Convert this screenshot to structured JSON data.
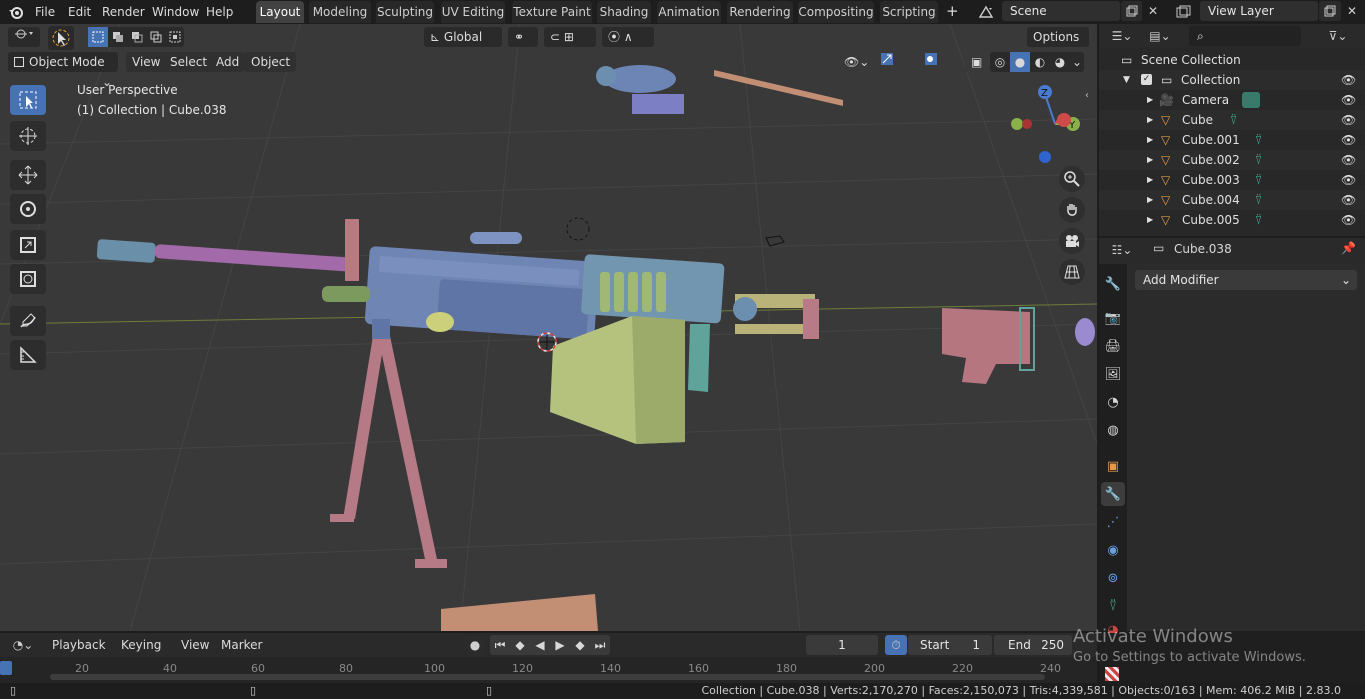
{
  "menu": {
    "items": [
      "File",
      "Edit",
      "Render",
      "Window",
      "Help"
    ]
  },
  "workspaces": {
    "tabs": [
      "Layout",
      "Modeling",
      "Sculpting",
      "UV Editing",
      "Texture Paint",
      "Shading",
      "Animation",
      "Rendering",
      "Compositing",
      "Scripting"
    ],
    "active": "Layout",
    "add_label": "+"
  },
  "scene": {
    "name": "Scene",
    "view_layer": "View Layer"
  },
  "viewport": {
    "mode_label": "Object Mode",
    "menus": [
      "View",
      "Select",
      "Add",
      "Object"
    ],
    "orientation": "Global",
    "options_label": "Options",
    "overlay_line1": "User Perspective",
    "overlay_line2": "(1) Collection | Cube.038",
    "gizmo_axes": {
      "z": "Z",
      "y": "Y"
    }
  },
  "outliner": {
    "search_placeholder": "",
    "root": "Scene Collection",
    "collection": "Collection",
    "items": [
      "Camera",
      "Cube",
      "Cube.001",
      "Cube.002",
      "Cube.003",
      "Cube.004",
      "Cube.005"
    ]
  },
  "properties": {
    "object_name": "Cube.038",
    "add_modifier_label": "Add Modifier"
  },
  "timeline": {
    "menus": [
      "Playback",
      "Keying",
      "View",
      "Marker"
    ],
    "current_frame": "1",
    "start_label": "Start",
    "start_value": "1",
    "end_label": "End",
    "end_value": "250",
    "ruler_ticks": [
      "20",
      "40",
      "60",
      "80",
      "100",
      "120",
      "140",
      "160",
      "180",
      "200",
      "220",
      "240"
    ]
  },
  "status": {
    "text": "Collection | Cube.038 | Verts:2,170,270 | Faces:2,150,073 | Tris:4,339,581 | Objects:0/163 | Mem: 406.2 MiB | 2.83.0"
  },
  "watermark": {
    "title": "Activate Windows",
    "subtitle": "Go to Settings to activate Windows."
  },
  "colors": {
    "accent": "#4772b3",
    "viewport_bg": "#393939",
    "panel_bg": "#2b2b2b",
    "header_bg": "#1d1d1d",
    "model_blue": "#6c86b5",
    "model_purple": "#9a6aa6",
    "model_teal": "#5f9aa8",
    "model_green": "#a8be7b",
    "model_pink": "#b57a86",
    "model_tan": "#c98e74"
  }
}
